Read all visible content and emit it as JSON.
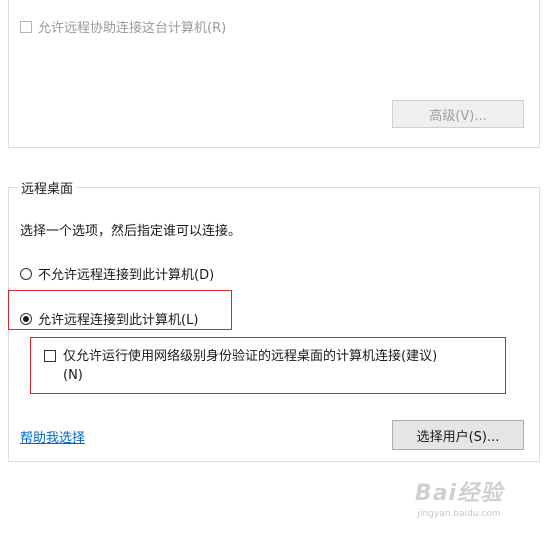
{
  "remote_assistance": {
    "allow_label": "允许远程协助连接这台计算机(R)",
    "advanced_button": "高级(V)..."
  },
  "remote_desktop": {
    "group_title": "远程桌面",
    "instruction": "选择一个选项，然后指定谁可以连接。",
    "option_deny": "不允许远程连接到此计算机(D)",
    "option_allow": "允许远程连接到此计算机(L)",
    "nla_line1": "仅允许运行使用网络级别身份验证的远程桌面的计算机连接(建议)",
    "nla_line2": "(N)",
    "help_link": "帮助我选择",
    "select_users_button": "选择用户(S)..."
  },
  "watermark": {
    "main": "Bai经验",
    "sub": "jingyan.baidu.com"
  },
  "colors": {
    "highlight": "#d9262b",
    "link": "#0066cc"
  }
}
